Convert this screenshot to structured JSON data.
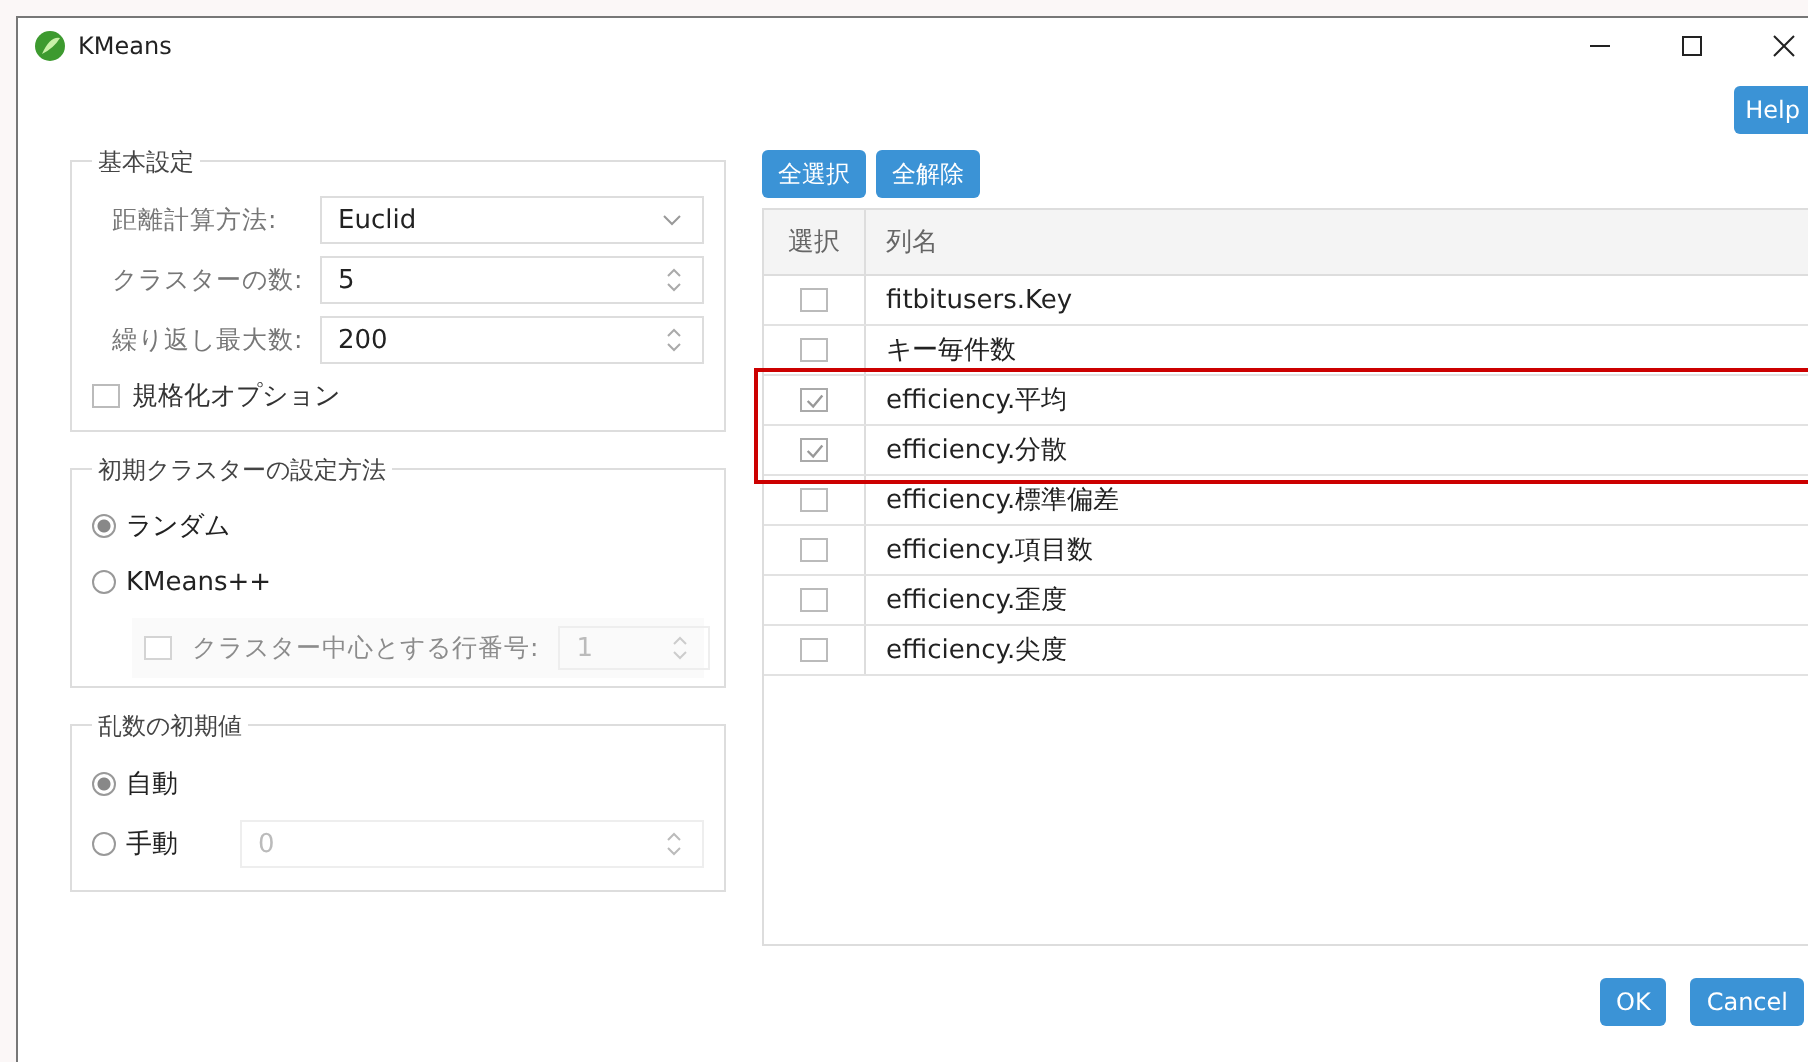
{
  "window": {
    "title": "KMeans"
  },
  "help_button": "Help",
  "basic": {
    "title": "基本設定",
    "fields": [
      {
        "label": "距離計算方法:",
        "value": "Euclid",
        "kind": "select"
      },
      {
        "label": "クラスターの数:",
        "value": "5",
        "kind": "spin"
      },
      {
        "label": "繰り返し最大数:",
        "value": "200",
        "kind": "spin"
      }
    ],
    "normalize": {
      "label": "規格化オプション",
      "checked": false
    }
  },
  "init": {
    "title": "初期クラスターの設定方法",
    "options": [
      {
        "label": "ランダム",
        "selected": true
      },
      {
        "label": "KMeans++",
        "selected": false
      }
    ],
    "center_row": {
      "label": "クラスター中心とする行番号:",
      "value": "1",
      "checked": false,
      "disabled": true
    }
  },
  "seed": {
    "title": "乱数の初期値",
    "options": [
      {
        "label": "自動",
        "selected": true
      },
      {
        "label": "手動",
        "selected": false,
        "value": "0"
      }
    ]
  },
  "column_buttons": [
    "全選択",
    "全解除"
  ],
  "table": {
    "columns": [
      "選択",
      "列名"
    ],
    "rows": [
      {
        "name": "fitbitusers.Key",
        "checked": false,
        "highlighted": false
      },
      {
        "name": "キー毎件数",
        "checked": false,
        "highlighted": false
      },
      {
        "name": "efficiency.平均",
        "checked": true,
        "highlighted": true
      },
      {
        "name": "efficiency.分散",
        "checked": true,
        "highlighted": true
      },
      {
        "name": "efficiency.標準偏差",
        "checked": false,
        "highlighted": false
      },
      {
        "name": "efficiency.項目数",
        "checked": false,
        "highlighted": false
      },
      {
        "name": "efficiency.歪度",
        "checked": false,
        "highlighted": false
      },
      {
        "name": "efficiency.尖度",
        "checked": false,
        "highlighted": false
      }
    ]
  },
  "footer_buttons": [
    "OK",
    "Cancel"
  ]
}
